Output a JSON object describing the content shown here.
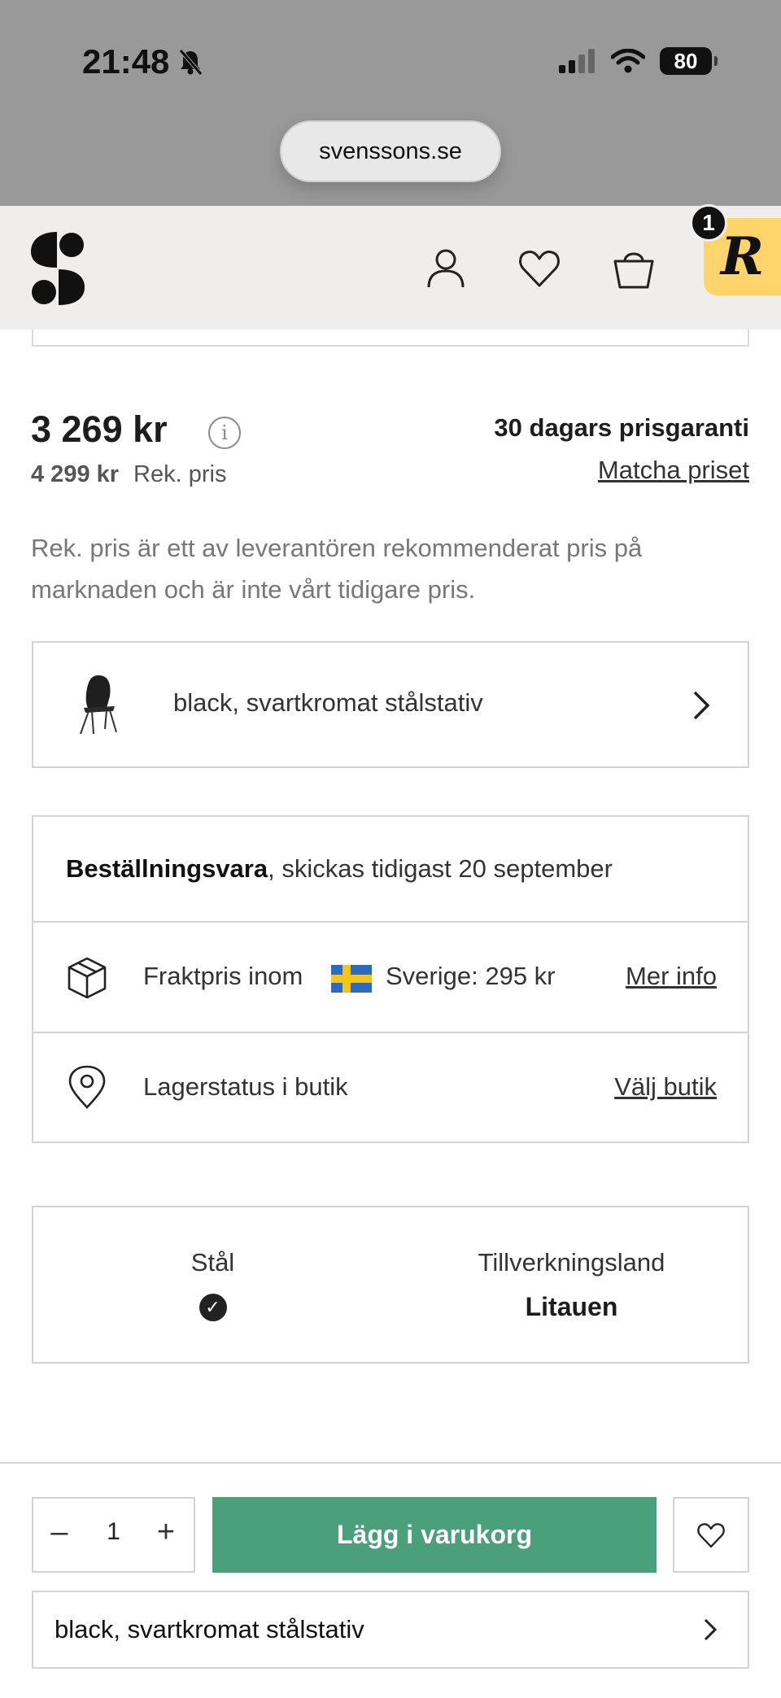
{
  "status_bar": {
    "time": "21:48",
    "battery": "80",
    "url": "svenssons.se"
  },
  "header": {
    "logo": "svenssons-logo",
    "icons": [
      "user-icon",
      "heart-icon",
      "bag-icon"
    ],
    "rewards_letter": "R",
    "rewards_count": "1"
  },
  "price": {
    "current": "3 269 kr",
    "original": "4 299 kr",
    "original_label": "Rek. pris",
    "guarantee": "30 dagars prisgaranti",
    "match_link": "Matcha priset",
    "disclaimer": "Rek. pris är ett av leverantören rekommenderat pris på marknaden och är inte vårt tidigare pris."
  },
  "variant": {
    "label": "black, svartkromat stålstativ"
  },
  "delivery": {
    "order_item_bold": "Beställningsvara",
    "order_item_rest": ", skickas tidigast 20 september",
    "shipping_prefix": "Fraktpris inom",
    "shipping_suffix": "Sverige: 295 kr",
    "shipping_link": "Mer info",
    "stock_label": "Lagerstatus i butik",
    "stock_link": "Välj butik"
  },
  "specs": {
    "material_title": "Stål",
    "country_title": "Tillverkningsland",
    "country_value": "Litauen"
  },
  "purchase": {
    "quantity": "1",
    "minus": "–",
    "plus": "+",
    "add_to_cart": "Lägg i varukorg",
    "variant_label": "black, svartkromat stålstativ"
  },
  "colors": {
    "cart_button": "#4aa07a",
    "rewards_badge": "#ffd56b",
    "header_bg": "#efeeec"
  }
}
